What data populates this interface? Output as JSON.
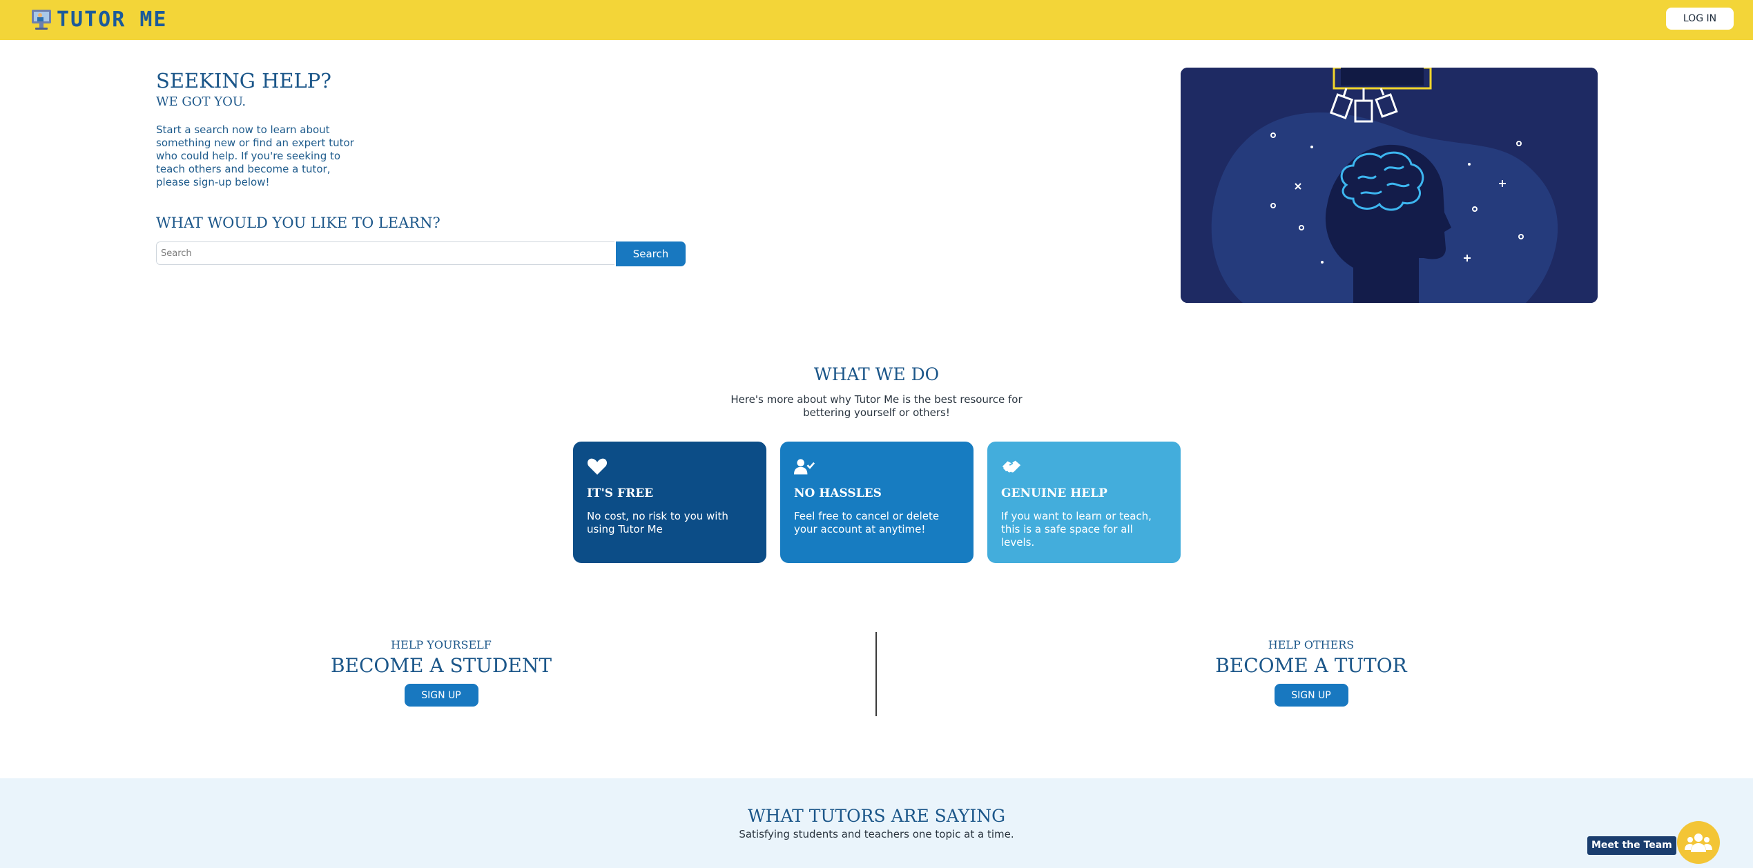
{
  "header": {
    "logo_text": "TUTOR ME",
    "login_label": "LOG IN"
  },
  "hero": {
    "title": "SEEKING HELP?",
    "subtitle": "WE GOT YOU.",
    "description": "Start a search now to learn about something new or find an expert tutor who could help. If you're seeking to teach others and become a tutor, please sign-up below!",
    "learn_title": "WHAT WOULD YOU LIKE TO LEARN?",
    "search_placeholder": "Search",
    "search_button": "Search",
    "illustration": "brain-head-illustration"
  },
  "what_we_do": {
    "title": "WHAT WE DO",
    "description_line1": "Here's more about why Tutor Me is the best resource for",
    "description_line2": "bettering yourself or others!",
    "cards": [
      {
        "icon": "heart-icon",
        "title": "IT'S FREE",
        "text": "No cost, no risk to you with using Tutor Me",
        "color": "#0c4d87"
      },
      {
        "icon": "user-check-icon",
        "title": "NO HASSLES",
        "text": "Feel free to cancel or delete your account at anytime!",
        "color": "#177cc1"
      },
      {
        "icon": "handshake-icon",
        "title": "GENUINE HELP",
        "text": "If you want to learn or teach, this is a safe space for all levels.",
        "color": "#43addc"
      }
    ]
  },
  "become": {
    "student": {
      "small": "HELP YOURSELF",
      "big": "BECOME A STUDENT",
      "button": "SIGN UP"
    },
    "tutor": {
      "small": "HELP OTHERS",
      "big": "BECOME A TUTOR",
      "button": "SIGN UP"
    }
  },
  "testimonials": {
    "title": "WHAT TUTORS ARE SAYING",
    "description": "Satisfying students and teachers one topic at a time."
  },
  "meet_team": {
    "label": "Meet the Team",
    "icon": "users-icon"
  },
  "colors": {
    "header_bg": "#f3d538",
    "primary": "#1878c0",
    "heading": "#1b5689",
    "testimonials_bg": "#eaf4fb"
  }
}
